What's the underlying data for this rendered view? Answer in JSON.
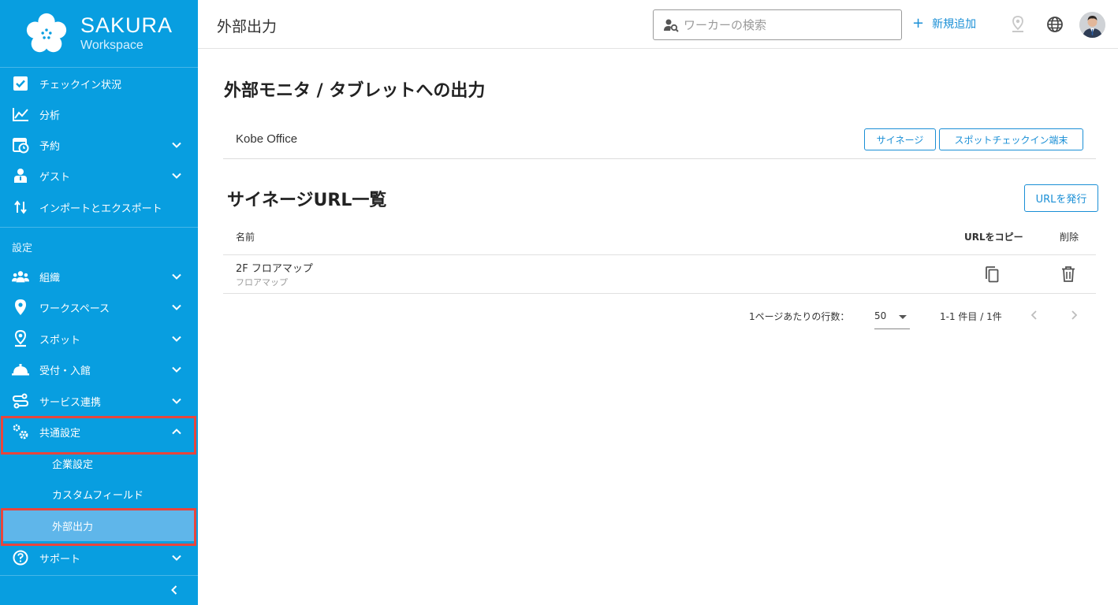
{
  "brand": {
    "name": "SAKURA",
    "sub": "Workspace"
  },
  "colors": {
    "sidebar": "#089ee0",
    "accent": "#1a8fd6",
    "highlight": "#e8453c",
    "active_item": "#5fb6ea"
  },
  "sidebar": {
    "items": [
      {
        "label": "チェックイン状況",
        "icon": "checkbox-icon"
      },
      {
        "label": "分析",
        "icon": "chart-line-icon"
      },
      {
        "label": "予約",
        "icon": "calendar-clock-icon"
      },
      {
        "label": "ゲスト",
        "icon": "guest-icon"
      },
      {
        "label": "インポートとエクスポート",
        "icon": "import-export-icon"
      }
    ],
    "settings_title": "設定",
    "settings_items": [
      {
        "label": "組織",
        "icon": "people-icon"
      },
      {
        "label": "ワークスペース",
        "icon": "location-pin-icon"
      },
      {
        "label": "スポット",
        "icon": "spot-pin-icon"
      },
      {
        "label": "受付・入館",
        "icon": "reception-bell-icon"
      },
      {
        "label": "サービス連携",
        "icon": "integration-icon"
      },
      {
        "label": "共通設定",
        "icon": "gears-icon"
      }
    ],
    "sub_items": [
      {
        "label": "企業設定"
      },
      {
        "label": "カスタムフィールド"
      },
      {
        "label": "外部出力"
      }
    ],
    "support": {
      "label": "サポート",
      "icon": "help-circle-icon"
    }
  },
  "header": {
    "title": "外部出力",
    "search_placeholder": "ワーカーの検索",
    "add_new": "新規追加"
  },
  "main": {
    "title": "外部モニタ / タブレットへの出力",
    "office_name": "Kobe Office",
    "signage_button": "サイネージ",
    "spot_checkin_button": "スポットチェックイン端末",
    "list_title": "サイネージURL一覧",
    "issue_url_button": "URLを発行",
    "table": {
      "headers": {
        "name": "名前",
        "copy": "URLをコピー",
        "delete": "削除"
      },
      "rows": [
        {
          "name": "2F フロアマップ",
          "subtitle": "フロアマップ"
        }
      ]
    },
    "pagination": {
      "rows_per_page_label": "1ページあたりの行数：",
      "rows_per_page": "50",
      "range": "1-1 件目 / 1件"
    }
  }
}
